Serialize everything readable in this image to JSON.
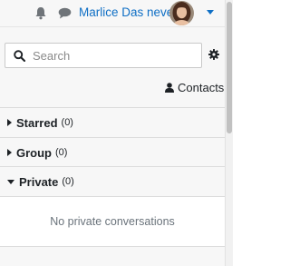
{
  "header": {
    "user_name": "Marlice Das neves",
    "icons": {
      "notifications": "bell-icon",
      "messages": "chat-bubble-icon",
      "user_menu": "caret-down-icon"
    },
    "accent_color": "#0f6fc5"
  },
  "drawer": {
    "search": {
      "placeholder": "Search",
      "value": ""
    },
    "contacts_label": "Contacts",
    "sections": [
      {
        "title": "Starred",
        "count": "(0)",
        "expanded": false
      },
      {
        "title": "Group",
        "count": "(0)",
        "expanded": false
      },
      {
        "title": "Private",
        "count": "(0)",
        "expanded": true
      }
    ],
    "private_empty_message": "No private conversations"
  }
}
